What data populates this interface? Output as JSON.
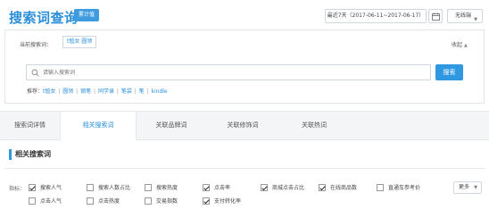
{
  "header": {
    "title": "搜索词查询",
    "badge": "累计值",
    "date_range": "最近7天（2017-06-11~2017-06-17）",
    "device": "无线端"
  },
  "search_panel": {
    "current_label": "当前搜索词：",
    "current_tag": "t恤女 圆领",
    "collapse": "收起",
    "placeholder": "请输入搜索词",
    "search_button": "搜索",
    "recommend_label": "推荐：",
    "recommend": [
      "t恤女",
      "圆领",
      "钢笔",
      "同学录",
      "笔袋",
      "笔",
      "kindle"
    ]
  },
  "tabs": [
    {
      "label": "搜索词详情",
      "active": false
    },
    {
      "label": "相关搜索词",
      "active": true
    },
    {
      "label": "关联品牌词",
      "active": false
    },
    {
      "label": "关联修饰词",
      "active": false
    },
    {
      "label": "关联热词",
      "active": false
    }
  ],
  "section": {
    "title": "相关搜索词"
  },
  "metrics": {
    "label": "指标：",
    "more": "更多",
    "items": [
      {
        "label": "搜索人气",
        "checked": true
      },
      {
        "label": "搜索人数占比",
        "checked": false
      },
      {
        "label": "搜索热度",
        "checked": false
      },
      {
        "label": "点击率",
        "checked": true
      },
      {
        "label": "商城点击占比",
        "checked": true
      },
      {
        "label": "在线商品数",
        "checked": true
      },
      {
        "label": "直通车参考价",
        "checked": false
      },
      {
        "label": "点击人气",
        "checked": false
      },
      {
        "label": "点击热度",
        "checked": false
      },
      {
        "label": "交易指数",
        "checked": false
      },
      {
        "label": "支付转化率",
        "checked": true
      }
    ]
  },
  "colors": {
    "accent": "#2f98e0",
    "text": "#333333"
  }
}
